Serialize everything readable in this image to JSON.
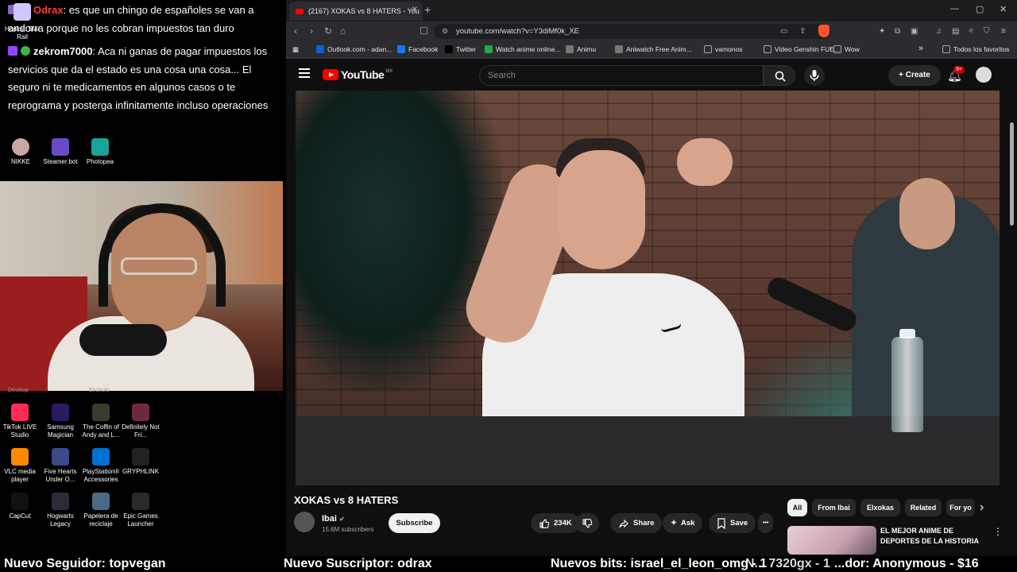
{
  "chat": {
    "messages": [
      {
        "user": "Odrax",
        "user_color": "#ff3b3b",
        "text": ": es que un chingo de españoles se van a andorra porque no les cobran impuestos tan duro"
      },
      {
        "user": "zekrom7000",
        "user_color": "#ffffff",
        "text": ": Aca ni ganas de pagar impuestos los servicios que da el estado es una cosa una cosa... El seguro ni te medicamentos en algunos casos o te reprograma y posterga infinitamente incluso operaciones"
      }
    ]
  },
  "desktop": {
    "overlay_labels": [
      "Honkai: Star Rail",
      "NIKKE",
      "Steamer.bot",
      "Photopea"
    ],
    "row_labels_partial": [
      "Desktop",
      "Enchufo"
    ],
    "icons": [
      {
        "label": "TikTok LIVE Studio",
        "icon": "tiktok-icon",
        "color": "#ff2d55"
      },
      {
        "label": "Samsung Magician",
        "icon": "samsung-magician-icon",
        "color": "#2a1a5e"
      },
      {
        "label": "The Coffin of Andy and L...",
        "icon": "coffin-game-icon",
        "color": "#3b3b2b"
      },
      {
        "label": "Definitely Not Fri...",
        "icon": "game-icon",
        "color": "#6b2b3b"
      },
      {
        "label": "VLC media player",
        "icon": "vlc-icon",
        "color": "#ff8800"
      },
      {
        "label": "Five Hearts Under O...",
        "icon": "game-icon",
        "color": "#3a4a8a"
      },
      {
        "label": "PlayStation® Accessories",
        "icon": "playstation-icon",
        "color": "#0070d1"
      },
      {
        "label": "GRYPHLINK",
        "icon": "gryphlink-icon",
        "color": "#222222"
      },
      {
        "label": "CapCut",
        "icon": "capcut-icon",
        "color": "#111111"
      },
      {
        "label": "Hogwarts Legacy",
        "icon": "hogwarts-icon",
        "color": "#2b2b3b"
      },
      {
        "label": "Papelera de reciclaje",
        "icon": "recycle-bin-icon",
        "color": "#4a6a8a"
      },
      {
        "label": "Epic Games Launcher",
        "icon": "epic-games-icon",
        "color": "#2a2a2a"
      }
    ]
  },
  "browser": {
    "tab_title": "(2167) XOKAS vs 8 HATERS - You",
    "tab_close": "✕",
    "new_tab": "+",
    "url": "youtube.com/watch?v=Y3diMf0k_XE",
    "bookmarks": [
      {
        "label": "Outlook.com - adan...",
        "icon": "outlook-icon",
        "color": "#0a64d2"
      },
      {
        "label": "Facebook",
        "icon": "facebook-icon",
        "color": "#1877f2"
      },
      {
        "label": "Twitter",
        "icon": "x-icon",
        "color": "#000000"
      },
      {
        "label": "Watch anime online...",
        "icon": "anime-icon",
        "color": "#22aa44"
      },
      {
        "label": "Animu",
        "icon": "animu-icon",
        "color": "#777777"
      },
      {
        "label": "Aniwatch Free Anim...",
        "icon": "aniwatch-icon",
        "color": "#777777"
      },
      {
        "label": "vamonos",
        "icon": "folder-icon",
        "color": "#aaaaaa"
      },
      {
        "label": "Video Genshin FUE...",
        "icon": "folder-icon",
        "color": "#aaaaaa"
      },
      {
        "label": "Wow",
        "icon": "folder-icon",
        "color": "#aaaaaa"
      }
    ],
    "bookmarks_more": "»",
    "all_bookmarks": "Todos los favoritos"
  },
  "youtube": {
    "logo_word": "YouTube",
    "region": "MX",
    "search_placeholder": "Search",
    "create_label": "Create",
    "notif_count": "9+",
    "video_title": "XOKAS vs 8 HATERS",
    "channel_name": "Ibai",
    "channel_subs": "15.6M subscribers",
    "subscribe_label": "Subscribe",
    "likes": "234K",
    "share_label": "Share",
    "ask_label": "Ask",
    "save_label": "Save",
    "more_label": "•••",
    "chips": [
      "All",
      "From Ibai",
      "Elxokas",
      "Related",
      "For yo"
    ],
    "chips_next": "›",
    "rec_title": "EL MEJOR ANIME DE DEPORTES DE LA HISTORIA",
    "rec_more": "⋮",
    "accent": "#ff0000"
  },
  "ticker": {
    "items": [
      "Nuevo Seguidor: topvegan",
      "Nuevo Suscriptor: odrax",
      "Nuevos bits: israel_el_leon_omg - 1",
      "N... 7320gx - 1",
      "...dor: Anonymous - $16"
    ]
  }
}
